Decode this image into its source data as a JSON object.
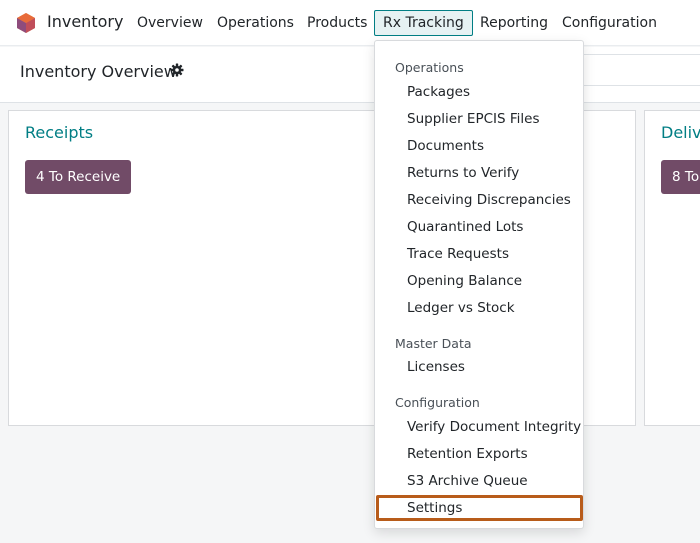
{
  "app": {
    "name": "Inventory"
  },
  "nav": {
    "items": [
      {
        "label": "Overview"
      },
      {
        "label": "Operations"
      },
      {
        "label": "Products"
      },
      {
        "label": "Rx Tracking"
      },
      {
        "label": "Reporting"
      },
      {
        "label": "Configuration"
      }
    ]
  },
  "page": {
    "title": "Inventory Overview"
  },
  "cards": [
    {
      "title": "Receipts",
      "button": "4 To Receive"
    },
    {
      "title": "Delive",
      "button": "8 To"
    }
  ],
  "dropdown": {
    "sections": [
      {
        "header": "Operations",
        "items": [
          "Packages",
          "Supplier EPCIS Files",
          "Documents",
          "Returns to Verify",
          "Receiving Discrepancies",
          "Quarantined Lots",
          "Trace Requests",
          "Opening Balance",
          "Ledger vs Stock"
        ]
      },
      {
        "header": "Master Data",
        "items": [
          "Licenses"
        ]
      },
      {
        "header": "Configuration",
        "items": [
          "Verify Document Integrity",
          "Retention Exports",
          "S3 Archive Queue",
          "Settings"
        ]
      }
    ]
  },
  "colors": {
    "accent": "#017e84",
    "brand_button": "#714b67",
    "highlight_outline": "#b85c1a"
  },
  "icons": {
    "app_logo": "inventory-cube-icon",
    "settings": "gear-icon"
  }
}
